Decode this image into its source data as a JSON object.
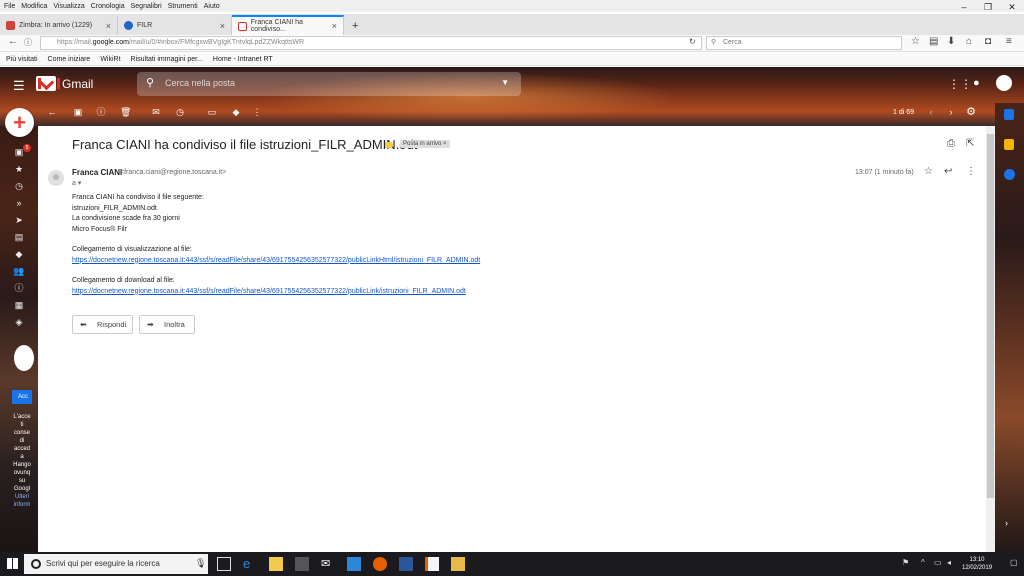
{
  "browser": {
    "menu": [
      "File",
      "Modifica",
      "Visualizza",
      "Cronologia",
      "Segnalibri",
      "Strumenti",
      "Aiuto"
    ],
    "tabs": [
      {
        "label": "Zimbra: In arrivo (1229)",
        "icon_color": "#d0433a"
      },
      {
        "label": "FILR",
        "icon_color": "#1e66c7"
      },
      {
        "label": "Franca CIANI ha condiviso...",
        "icon_color": "#d93025",
        "active": true
      }
    ],
    "url_prefix": "https://mail.",
    "url_domain": "google.com",
    "url_rest": "/mail/u/0/#inbox/FMfcgxwBVgIgKTntvlqLpdZZWkqttsWR",
    "search_placeholder": "Cerca",
    "bookmarks": [
      "Più visitati",
      "Come iniziare",
      "WikiRt",
      "Risultati immagini per...",
      "Home - Intranet RT"
    ]
  },
  "gmail": {
    "brand": "Gmail",
    "search_placeholder": "Cerca nella posta",
    "pager": "1 di 69",
    "inbox_badge": "5",
    "hangout_text": [
      "L'acce",
      "ti",
      "conse",
      "di",
      "acced",
      "a",
      "Hango",
      "ovunq",
      "su",
      "Googl"
    ],
    "hangout_links": [
      "Ulteri",
      "inform"
    ],
    "access_button": "Acc"
  },
  "message": {
    "subject": "Franca CIANI ha condiviso il file istruzioni_FILR_ADMIN.odt",
    "label": "Posta in arrivo",
    "label_close": "×",
    "sender_name": "Franca CIANI",
    "sender_email": "<franca.ciani@regione.toscana.it>",
    "to": "a",
    "time": "13:07 (1 minuto fa)",
    "body_lines": [
      "Franca CIANI ha condiviso il file seguente:",
      "istruzioni_FILR_ADMIN.odt",
      "La condivisione scade fra 30 giorni",
      "Micro Focus® Filr"
    ],
    "view_label": "Collegamento di visualizzazione al file:",
    "view_link": "https://docnetnew.regione.toscana.it:443/ssf/s/readFile/share/43/6917554256352577322/publicLinkHtml/istruzioni_FILR_ADMIN.odt",
    "download_label": "Collegamento di download al file:",
    "download_link": "https://docnetnew.regione.toscana.it:443/ssf/s/readFile/share/43/6917554256352577322/publicLink/istruzioni_FILR_ADMIN.odt",
    "reply_button": "Rispondi",
    "forward_button": "Inoltra"
  },
  "taskbar": {
    "search_placeholder": "Scrivi qui per eseguire la ricerca",
    "time": "13:10",
    "date": "12/02/2019"
  }
}
